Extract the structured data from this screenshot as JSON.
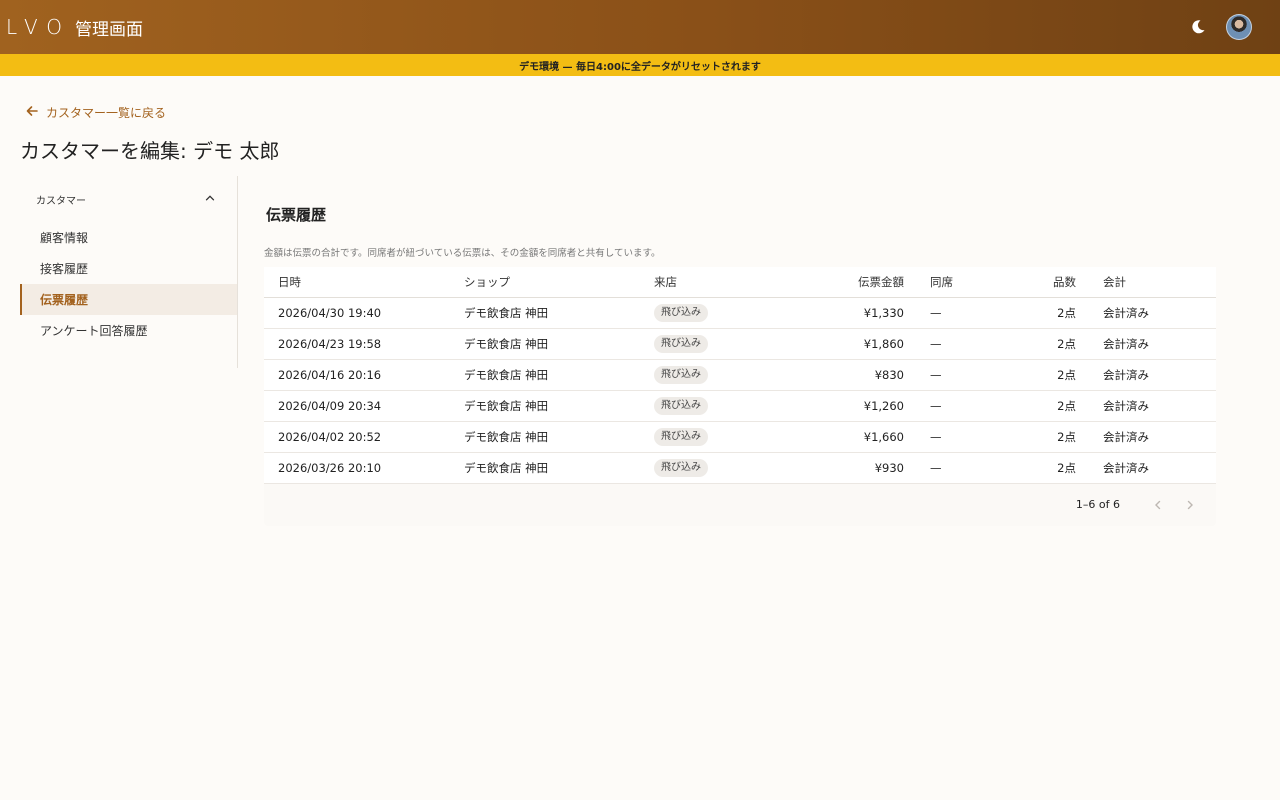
{
  "app": {
    "logo": "LVO",
    "title": "管理画面"
  },
  "banner": {
    "text": "デモ環境 — 毎日4:00に全データがリセットされます"
  },
  "nav": {
    "back_label": "カスタマー一覧に戻る"
  },
  "page": {
    "title": "カスタマーを編集: デモ 太郎"
  },
  "sidebar": {
    "group_label": "カスタマー",
    "items": [
      {
        "label": "顧客情報"
      },
      {
        "label": "接客履歴"
      },
      {
        "label": "伝票履歴"
      },
      {
        "label": "アンケート回答履歴"
      }
    ]
  },
  "section": {
    "title": "伝票履歴",
    "note": "金額は伝票の合計です。同席者が紐づいている伝票は、その金額を同席者と共有しています。"
  },
  "table": {
    "headers": [
      "日時",
      "ショップ",
      "来店",
      "伝票金額",
      "同席",
      "品数",
      "会計"
    ],
    "rows": [
      [
        "2026/04/30 19:40",
        "デモ飲食店 神田",
        "飛び込み",
        "¥1,330",
        "—",
        "2点",
        "会計済み"
      ],
      [
        "2026/04/23 19:58",
        "デモ飲食店 神田",
        "飛び込み",
        "¥1,860",
        "—",
        "2点",
        "会計済み"
      ],
      [
        "2026/04/16 20:16",
        "デモ飲食店 神田",
        "飛び込み",
        "¥830",
        "—",
        "2点",
        "会計済み"
      ],
      [
        "2026/04/09 20:34",
        "デモ飲食店 神田",
        "飛び込み",
        "¥1,260",
        "—",
        "2点",
        "会計済み"
      ],
      [
        "2026/04/02 20:52",
        "デモ飲食店 神田",
        "飛び込み",
        "¥1,660",
        "—",
        "2点",
        "会計済み"
      ],
      [
        "2026/03/26 20:10",
        "デモ飲食店 神田",
        "飛び込み",
        "¥930",
        "—",
        "2点",
        "会計済み"
      ]
    ]
  },
  "pagination": {
    "range": "1–6 of 6"
  },
  "icons": {
    "back": "arrow-left-icon",
    "theme": "moon-icon",
    "collapse": "chevron-up-icon",
    "prev": "chevron-left-icon",
    "next": "chevron-right-icon"
  },
  "colors": {
    "accent": "#a3621e",
    "appbar": "#8a5018",
    "banner": "#f3bd13"
  }
}
